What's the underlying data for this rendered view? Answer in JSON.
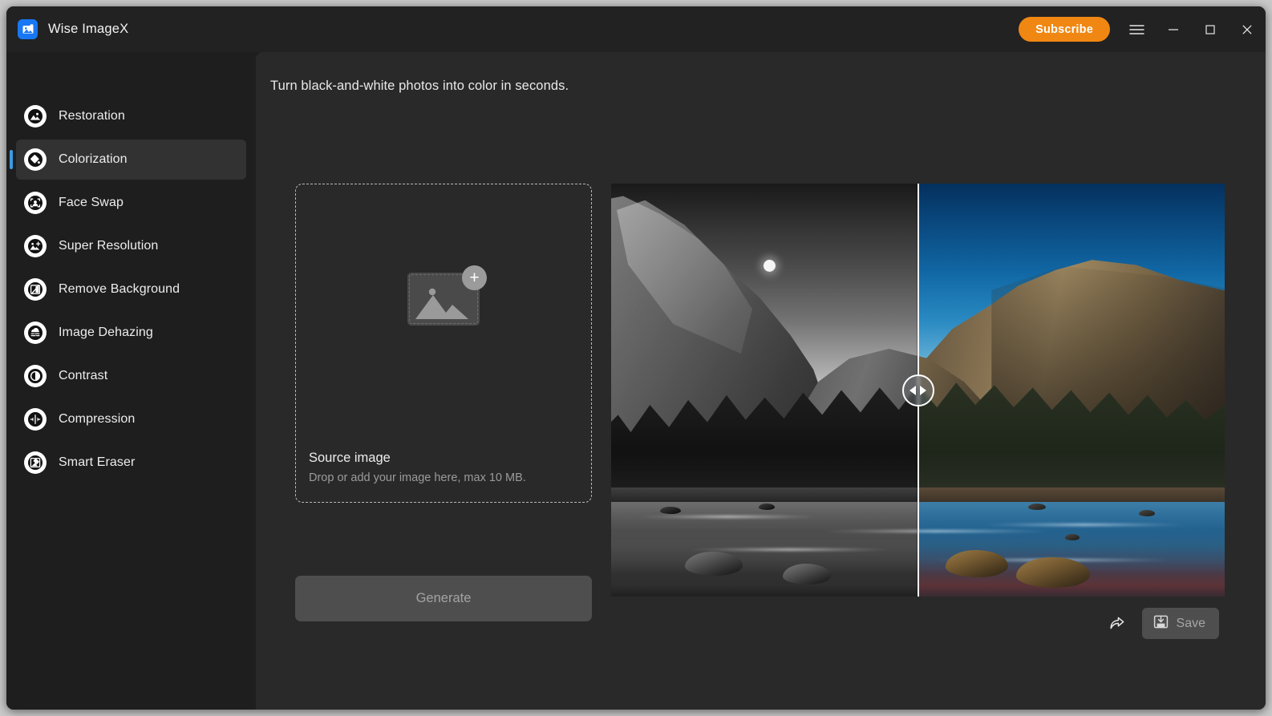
{
  "window": {
    "app_title": "Wise ImageX",
    "app_icon": "image-app-icon",
    "subscribe_label": "Subscribe",
    "menu_icon": "hamburger-menu-icon",
    "minimize_icon": "minimize-icon",
    "maximize_icon": "maximize-icon",
    "close_icon": "close-icon",
    "accent_orange": "#f08712",
    "accent_blue": "#3b9ae0",
    "titlebar_bg": "#222222",
    "sidebar_bg": "#1e1e1e",
    "main_bg": "#292929"
  },
  "sidebar": {
    "items": [
      {
        "label": "Restoration",
        "icon": "restoration-icon",
        "active": false
      },
      {
        "label": "Colorization",
        "icon": "colorization-icon",
        "active": true
      },
      {
        "label": "Face Swap",
        "icon": "face-swap-icon",
        "active": false
      },
      {
        "label": "Super Resolution",
        "icon": "super-resolution-icon",
        "active": false
      },
      {
        "label": "Remove Background",
        "icon": "remove-background-icon",
        "active": false
      },
      {
        "label": "Image Dehazing",
        "icon": "image-dehazing-icon",
        "active": false
      },
      {
        "label": "Contrast",
        "icon": "contrast-icon",
        "active": false
      },
      {
        "label": "Compression",
        "icon": "compression-icon",
        "active": false
      },
      {
        "label": "Smart Eraser",
        "icon": "smart-eraser-icon",
        "active": false
      }
    ]
  },
  "main": {
    "tagline": "Turn black-and-white photos into color in seconds.",
    "dropzone": {
      "title": "Source image",
      "subtitle": "Drop or add your image here, max 10 MB.",
      "add_icon": "plus-icon",
      "placeholder_icon": "image-placeholder-icon"
    },
    "generate_label": "Generate",
    "preview": {
      "handle_icon": "compare-slider-handle",
      "left_label": "black-and-white-original",
      "right_label": "colorized-result"
    },
    "actions": {
      "share_icon": "share-icon",
      "save_icon": "save-icon",
      "save_label": "Save"
    }
  }
}
